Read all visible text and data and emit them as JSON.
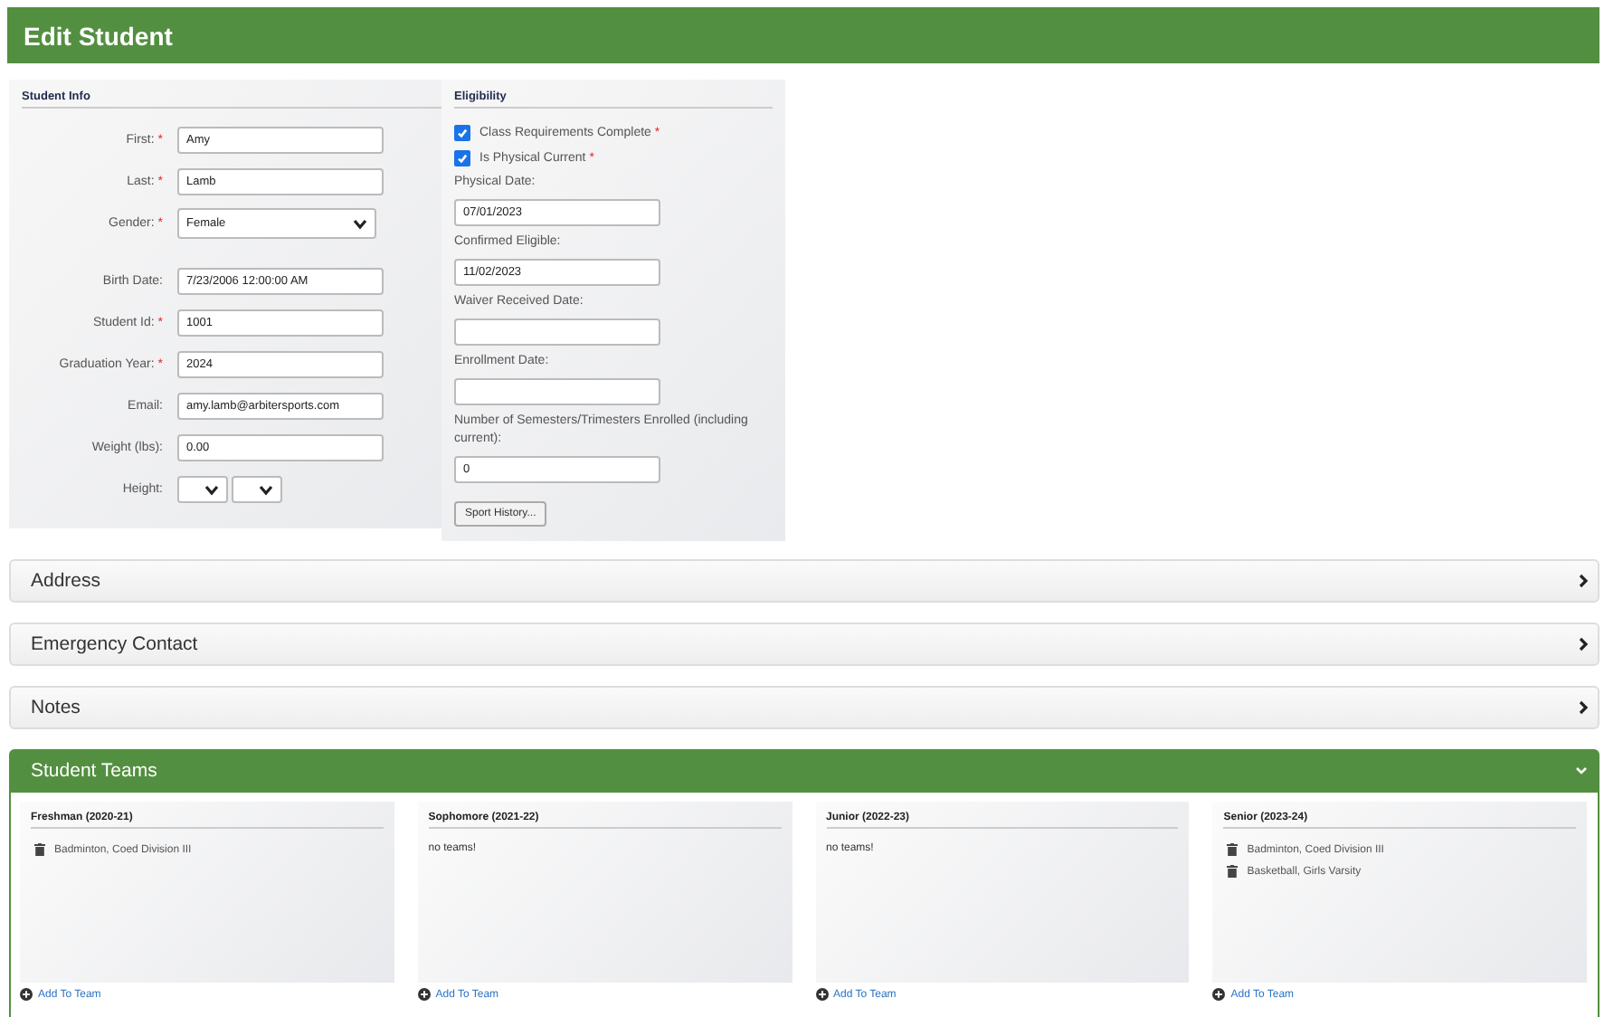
{
  "header": {
    "title": "Edit Student"
  },
  "student_info": {
    "title": "Student Info",
    "fields": [
      {
        "kind": "text",
        "label": "First:",
        "required_mark": "*",
        "value": "Amy"
      },
      {
        "kind": "text",
        "label": "Last:",
        "required_mark": "*",
        "value": "Lamb"
      },
      {
        "kind": "select",
        "label": "Gender:",
        "required_mark": "*",
        "value": "Female"
      },
      {
        "kind": "text",
        "label": "Birth Date:",
        "value": "7/23/2006 12:00:00 AM"
      },
      {
        "kind": "text",
        "label": "Student Id:",
        "required_mark": "*",
        "value": "1001"
      },
      {
        "kind": "text",
        "label": "Graduation Year:",
        "required_mark": "*",
        "value": "2024"
      },
      {
        "kind": "text",
        "label": "Email:",
        "value": "amy.lamb@arbitersports.com"
      },
      {
        "kind": "text",
        "label": "Weight (lbs):",
        "value": "0.00"
      },
      {
        "kind": "select_pair",
        "label": "Height:"
      }
    ]
  },
  "eligibility": {
    "title": "Eligibility",
    "checks": [
      {
        "label": "Class Requirements Complete",
        "required_mark": "*",
        "checked": true
      },
      {
        "label": "Is Physical Current",
        "required_mark": "*",
        "checked": true
      }
    ],
    "fields": [
      {
        "label": "Physical Date:",
        "value": "07/01/2023"
      },
      {
        "label": "Confirmed Eligible:",
        "value": "11/02/2023"
      },
      {
        "label": "Waiver Received Date:"
      },
      {
        "label": "Enrollment Date:"
      },
      {
        "label": "Number of Semesters/Trimesters Enrolled (including current):",
        "value": "0"
      }
    ],
    "button": "Sport History..."
  },
  "sections": [
    {
      "title": "Address",
      "expanded": false
    },
    {
      "title": "Emergency Contact",
      "expanded": false
    },
    {
      "title": "Notes",
      "expanded": false
    }
  ],
  "student_teams": {
    "title": "Student Teams",
    "expanded": true,
    "years": [
      {
        "title": "Freshman (2020-21)",
        "teams": [
          "Badminton, Coed Division III"
        ],
        "add_label": "Add To Team"
      },
      {
        "title": "Sophomore (2021-22)",
        "empty_text": "no teams!",
        "add_label": "Add To Team"
      },
      {
        "title": "Junior (2022-23)",
        "empty_text": "no teams!",
        "add_label": "Add To Team"
      },
      {
        "title": "Senior (2023-24)",
        "teams": [
          "Badminton, Coed Division III",
          "Basketball, Girls Varsity"
        ],
        "add_label": "Add To Team"
      }
    ]
  }
}
